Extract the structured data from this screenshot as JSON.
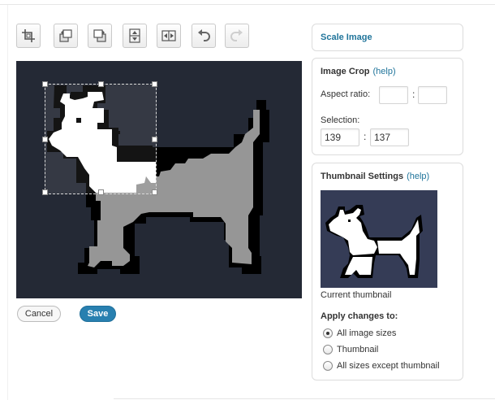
{
  "toolbar": {
    "buttons": [
      {
        "name": "crop-button",
        "icon": "crop-icon",
        "enabled": true
      },
      {
        "name": "rotate-left-button",
        "icon": "rotate-counterclockwise-icon",
        "enabled": true
      },
      {
        "name": "rotate-right-button",
        "icon": "rotate-clockwise-icon",
        "enabled": true
      },
      {
        "name": "flip-vertical-button",
        "icon": "flip-vertical-icon",
        "enabled": true
      },
      {
        "name": "flip-horizontal-button",
        "icon": "flip-horizontal-icon",
        "enabled": true
      },
      {
        "name": "undo-button",
        "icon": "undo-icon",
        "enabled": true
      },
      {
        "name": "redo-button",
        "icon": "redo-icon",
        "enabled": false
      }
    ]
  },
  "actions": {
    "cancel_label": "Cancel",
    "save_label": "Save"
  },
  "scale_panel": {
    "title": "Scale Image"
  },
  "crop_panel": {
    "title": "Image Crop",
    "help": "(help)",
    "aspect_label": "Aspect ratio:",
    "aspect_width": "",
    "aspect_height": "",
    "selection_label": "Selection:",
    "selection_width": "139",
    "selection_height": "137"
  },
  "thumb_panel": {
    "title": "Thumbnail Settings",
    "help": "(help)",
    "caption": "Current thumbnail",
    "apply_label": "Apply changes to:",
    "options": [
      {
        "label": "All image sizes",
        "checked": true
      },
      {
        "label": "Thumbnail",
        "checked": false
      },
      {
        "label": "All sizes except thumbnail",
        "checked": false
      }
    ]
  },
  "colors": {
    "accent": "#21759b",
    "save_button": "#2880b0",
    "canvas_bg": "#242935"
  }
}
